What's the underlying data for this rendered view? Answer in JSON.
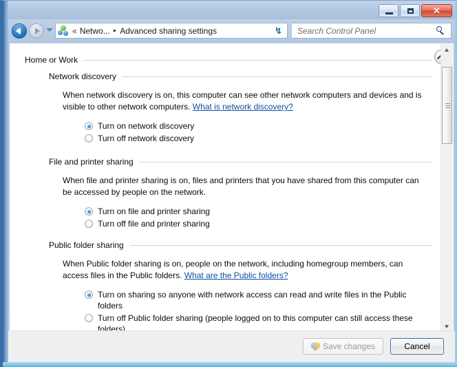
{
  "window": {
    "controls": {
      "minimize": "minimize",
      "maximize": "maximize",
      "close": "✕"
    }
  },
  "navbar": {
    "back": "Back",
    "forward": "Forward",
    "history_dropdown": "Recent pages",
    "address": {
      "overflow_chevron": "«",
      "segment_1": "Netwo...",
      "separator": "▸",
      "segment_2": "Advanced sharing settings",
      "dropdown": "Address dropdown"
    },
    "refresh": "↯",
    "search": {
      "placeholder": "Search Control Panel",
      "value": ""
    }
  },
  "profile": {
    "title": "Home or Work",
    "collapse": "Collapse"
  },
  "sections": [
    {
      "title": "Network discovery",
      "description_part1": "When network discovery is on, this computer can see other network computers and devices and is visible to other network computers. ",
      "link": "What is network discovery?",
      "options": [
        {
          "label": "Turn on network discovery",
          "checked": true
        },
        {
          "label": "Turn off network discovery",
          "checked": false
        }
      ]
    },
    {
      "title": "File and printer sharing",
      "description_part1": "When file and printer sharing is on, files and printers that you have shared from this computer can be accessed by people on the network.",
      "link": "",
      "options": [
        {
          "label": "Turn on file and printer sharing",
          "checked": true
        },
        {
          "label": "Turn off file and printer sharing",
          "checked": false
        }
      ]
    },
    {
      "title": "Public folder sharing",
      "description_part1": "When Public folder sharing is on, people on the network, including homegroup members, can access files in the Public folders. ",
      "link": "What are the Public folders?",
      "options": [
        {
          "label": "Turn on sharing so anyone with network access can read and write files in the Public folders",
          "checked": true
        },
        {
          "label": "Turn off Public folder sharing (people logged on to this computer can still access these folders)",
          "checked": false
        }
      ]
    }
  ],
  "footer": {
    "save_label": "Save changes",
    "save_disabled": true,
    "cancel_label": "Cancel"
  },
  "scrollbar": {
    "up": "▲",
    "down": "▼"
  },
  "colors": {
    "link": "#0b4f9e",
    "radio_accent": "#2a7fc0",
    "close_button": "#cf4a33",
    "frame": "#aec4e0"
  }
}
